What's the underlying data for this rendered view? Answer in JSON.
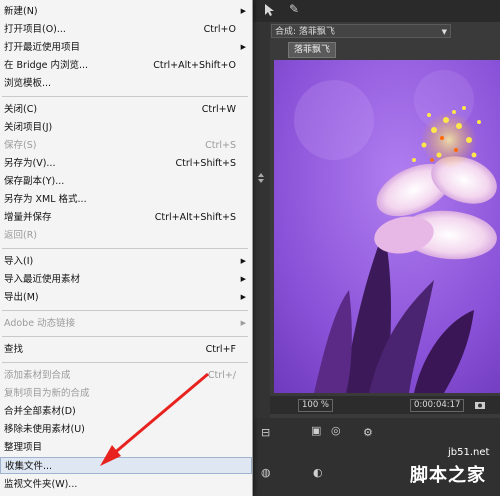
{
  "menu": {
    "items": [
      {
        "label": "新建(N)",
        "shortcut": "",
        "submenu": true,
        "disabled": false
      },
      {
        "label": "打开项目(O)...",
        "shortcut": "Ctrl+O",
        "submenu": false,
        "disabled": false
      },
      {
        "label": "打开最近使用项目",
        "shortcut": "",
        "submenu": true,
        "disabled": false
      },
      {
        "label": "在 Bridge 内浏览...",
        "shortcut": "Ctrl+Alt+Shift+O",
        "submenu": false,
        "disabled": false
      },
      {
        "label": "浏览模板...",
        "shortcut": "",
        "submenu": false,
        "disabled": false
      },
      {
        "label": "关闭(C)",
        "shortcut": "Ctrl+W",
        "submenu": false,
        "disabled": false
      },
      {
        "label": "关闭项目(J)",
        "shortcut": "",
        "submenu": false,
        "disabled": false
      },
      {
        "label": "保存(S)",
        "shortcut": "Ctrl+S",
        "submenu": false,
        "disabled": true
      },
      {
        "label": "另存为(V)...",
        "shortcut": "Ctrl+Shift+S",
        "submenu": false,
        "disabled": false
      },
      {
        "label": "保存副本(Y)...",
        "shortcut": "",
        "submenu": false,
        "disabled": false
      },
      {
        "label": "另存为 XML 格式...",
        "shortcut": "",
        "submenu": false,
        "disabled": false
      },
      {
        "label": "增量并保存",
        "shortcut": "Ctrl+Alt+Shift+S",
        "submenu": false,
        "disabled": false
      },
      {
        "label": "返回(R)",
        "shortcut": "",
        "submenu": false,
        "disabled": true
      },
      {
        "label": "导入(I)",
        "shortcut": "",
        "submenu": true,
        "disabled": false
      },
      {
        "label": "导入最近使用素材",
        "shortcut": "",
        "submenu": true,
        "disabled": false
      },
      {
        "label": "导出(M)",
        "shortcut": "",
        "submenu": true,
        "disabled": false
      },
      {
        "label": "Adobe 动态链接",
        "shortcut": "",
        "submenu": true,
        "disabled": true
      },
      {
        "label": "查找",
        "shortcut": "Ctrl+F",
        "submenu": false,
        "disabled": false
      },
      {
        "label": "添加素材到合成",
        "shortcut": "Ctrl+/",
        "submenu": false,
        "disabled": true
      },
      {
        "label": "复制项目为新的合成",
        "shortcut": "",
        "submenu": false,
        "disabled": true
      },
      {
        "label": "合并全部素材(D)",
        "shortcut": "",
        "submenu": false,
        "disabled": false
      },
      {
        "label": "移除未使用素材(U)",
        "shortcut": "",
        "submenu": false,
        "disabled": false
      },
      {
        "label": "整理项目",
        "shortcut": "",
        "submenu": false,
        "disabled": false
      },
      {
        "label": "收集文件...",
        "shortcut": "",
        "submenu": false,
        "disabled": false,
        "highlighted": true
      },
      {
        "label": "监视文件夹(W)...",
        "shortcut": "",
        "submenu": false,
        "disabled": false
      }
    ]
  },
  "panel": {
    "comp_title": "合成: 落菲飘飞",
    "comp_tab": "落菲飘飞",
    "zoom": "100 %",
    "timecode": "0:00:04:17"
  },
  "watermark": {
    "site": "jb51.net",
    "brand": "脚本之家"
  },
  "colors": {
    "menu_bg": "#f4f4f4",
    "highlight": "#dfe7f2",
    "arrow": "#e8231f",
    "viewport_purple": "#8a52d8"
  },
  "icons": [
    "submenu-arrow-icon",
    "selection-tool-icon",
    "pin-icon",
    "camera-icon",
    "red-arrow-annotation"
  ]
}
